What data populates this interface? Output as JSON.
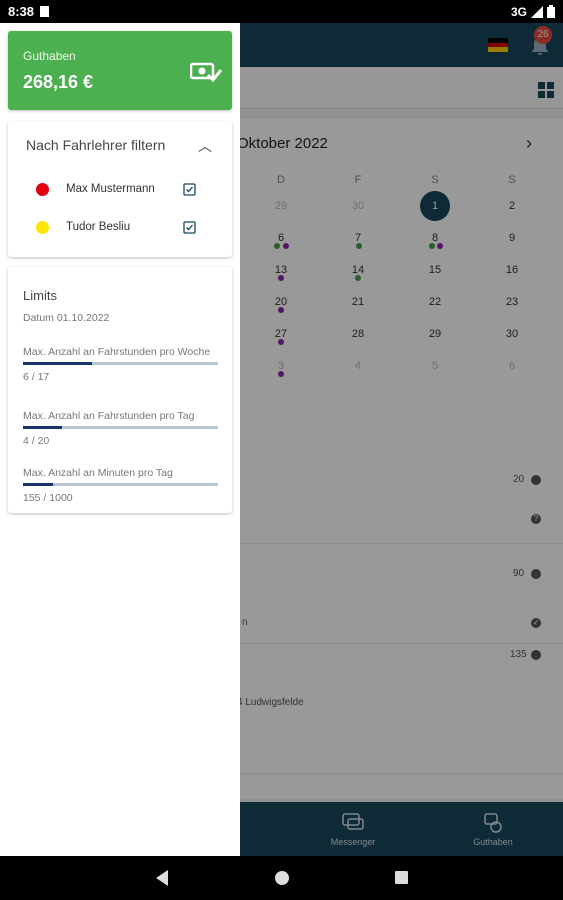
{
  "status": {
    "time": "8:38",
    "network": "3G"
  },
  "header": {
    "notification_count": "26"
  },
  "calendar": {
    "month_title": "Oktober 2022",
    "weekdays": [
      "D",
      "F",
      "S",
      "S"
    ],
    "days": {
      "r0": [
        "29",
        "30",
        "1",
        "2"
      ],
      "r1": [
        "6",
        "7",
        "8",
        "9"
      ],
      "r2": [
        "13",
        "14",
        "15",
        "16"
      ],
      "r3": [
        "20",
        "21",
        "22",
        "23"
      ],
      "r4": [
        "27",
        "28",
        "29",
        "30"
      ],
      "r5": [
        "3",
        "4",
        "5",
        "6"
      ]
    }
  },
  "list": {
    "r0_value": "20",
    "r1_value": "90",
    "r1_text": "n",
    "r2_value": "135",
    "r2_text": "4 Ludwigsfelde"
  },
  "bottom_nav": {
    "messenger": "Messenger",
    "credit": "Guthaben"
  },
  "drawer": {
    "balance": {
      "label": "Guthaben",
      "amount": "268,16 €"
    },
    "filter": {
      "title": "Nach Fahrlehrer filtern",
      "teachers": [
        {
          "name": "Max Mustermann",
          "color": "#e3000f",
          "checked": true
        },
        {
          "name": "Tudor Besliu",
          "color": "#ffe600",
          "checked": true
        }
      ]
    },
    "limits": {
      "title": "Limits",
      "date": "Datum 01.10.2022",
      "items": [
        {
          "label": "Max. Anzahl an Fahrstunden pro Woche",
          "value": "6 / 17",
          "fraction": 0.353
        },
        {
          "label": "Max. Anzahl an Fahrstunden pro Tag",
          "value": "4 / 20",
          "fraction": 0.2
        },
        {
          "label": "Max. Anzahl an Minuten pro Tag",
          "value": "155 / 1000",
          "fraction": 0.155
        }
      ]
    }
  },
  "colors": {
    "primary": "#17475a",
    "success": "#4caf50",
    "purple": "#8e24aa",
    "green": "#43a047"
  }
}
